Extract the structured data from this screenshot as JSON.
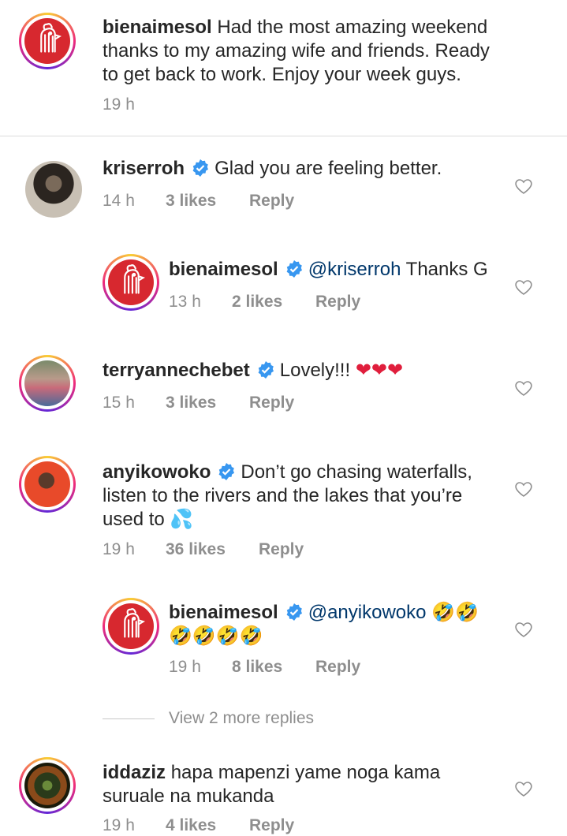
{
  "caption": {
    "username": "bienaimesol",
    "text_line1": "Had the most amazing weekend",
    "text_line2": "thanks to my amazing wife and friends. Ready",
    "text_line3": "to get back to work. Enjoy your week guys.",
    "time": "19 h"
  },
  "comments": [
    {
      "username": "kriserroh",
      "text": "Glad you are feeling better.",
      "time": "14 h",
      "likes": "3 likes",
      "reply": "Reply"
    },
    {
      "username": "bienaimesol",
      "mention": "@kriserroh",
      "text": "Thanks G",
      "time": "13 h",
      "likes": "2 likes",
      "reply": "Reply"
    },
    {
      "username": "terryannechebet",
      "text": "Lovely!!!",
      "emoji": "❤❤❤",
      "time": "15 h",
      "likes": "3 likes",
      "reply": "Reply"
    },
    {
      "username": "anyikowoko",
      "text_line1": "Don’t go chasing waterfalls,",
      "text_line2": "listen to the rivers and the lakes that you’re",
      "text_line3": "used to",
      "emoji": "💦",
      "time": "19 h",
      "likes": "36 likes",
      "reply": "Reply"
    },
    {
      "username": "bienaimesol",
      "mention": "@anyikowoko",
      "emoji_line1": "🤣🤣",
      "emoji_line2": "🤣🤣🤣🤣",
      "time": "19 h",
      "likes": "8 likes",
      "reply": "Reply"
    },
    {
      "username": "iddaziz",
      "text_line1": "hapa mapenzi yame noga kama",
      "text_line2": "suruale na mukanda",
      "time": "19 h",
      "likes": "4 likes",
      "reply": "Reply"
    }
  ],
  "view_more_replies": "View 2 more replies",
  "colors": {
    "text": "#262626",
    "secondary": "#8e8e8e",
    "mention": "#00376b",
    "verified": "#3897f0",
    "logo_red": "#d7282f"
  },
  "icons": [
    "heart-outline-icon",
    "verified-badge-icon",
    "rooster-logo-icon"
  ]
}
